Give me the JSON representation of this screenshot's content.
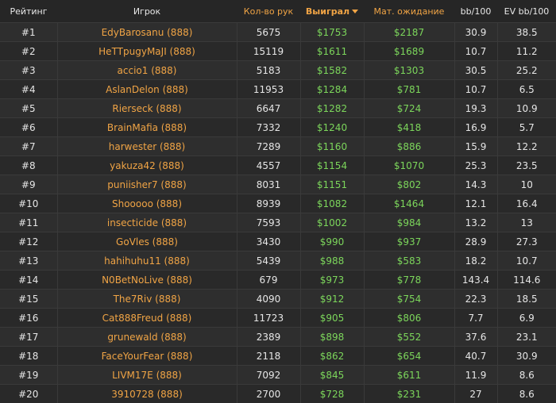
{
  "headers": {
    "rank": "Рейтинг",
    "player": "Игрок",
    "hands": "Кол-во рук",
    "won": "Выиграл",
    "ev": "Мат. ожидание",
    "bb100": "bb/100",
    "evbb100": "EV bb/100"
  },
  "sort": {
    "column": "won",
    "direction": "desc"
  },
  "colors": {
    "accent": "#f0a445",
    "money": "#7cd65b",
    "background": "#262626"
  },
  "rows": [
    {
      "rank": "#1",
      "player": "EdyBarosanu (888)",
      "hands": "5675",
      "won": "$1753",
      "ev": "$2187",
      "bb100": "30.9",
      "evbb100": "38.5"
    },
    {
      "rank": "#2",
      "player": "HeTTpugyMaJI (888)",
      "hands": "15119",
      "won": "$1611",
      "ev": "$1689",
      "bb100": "10.7",
      "evbb100": "11.2"
    },
    {
      "rank": "#3",
      "player": "accio1 (888)",
      "hands": "5183",
      "won": "$1582",
      "ev": "$1303",
      "bb100": "30.5",
      "evbb100": "25.2"
    },
    {
      "rank": "#4",
      "player": "AslanDelon (888)",
      "hands": "11953",
      "won": "$1284",
      "ev": "$781",
      "bb100": "10.7",
      "evbb100": "6.5"
    },
    {
      "rank": "#5",
      "player": "Rierseck (888)",
      "hands": "6647",
      "won": "$1282",
      "ev": "$724",
      "bb100": "19.3",
      "evbb100": "10.9"
    },
    {
      "rank": "#6",
      "player": "BrainMafia (888)",
      "hands": "7332",
      "won": "$1240",
      "ev": "$418",
      "bb100": "16.9",
      "evbb100": "5.7"
    },
    {
      "rank": "#7",
      "player": "harwester (888)",
      "hands": "7289",
      "won": "$1160",
      "ev": "$886",
      "bb100": "15.9",
      "evbb100": "12.2"
    },
    {
      "rank": "#8",
      "player": "yakuza42 (888)",
      "hands": "4557",
      "won": "$1154",
      "ev": "$1070",
      "bb100": "25.3",
      "evbb100": "23.5"
    },
    {
      "rank": "#9",
      "player": "puniisher7 (888)",
      "hands": "8031",
      "won": "$1151",
      "ev": "$802",
      "bb100": "14.3",
      "evbb100": "10"
    },
    {
      "rank": "#10",
      "player": "Shooooo (888)",
      "hands": "8939",
      "won": "$1082",
      "ev": "$1464",
      "bb100": "12.1",
      "evbb100": "16.4"
    },
    {
      "rank": "#11",
      "player": "insecticide (888)",
      "hands": "7593",
      "won": "$1002",
      "ev": "$984",
      "bb100": "13.2",
      "evbb100": "13"
    },
    {
      "rank": "#12",
      "player": "GoVles (888)",
      "hands": "3430",
      "won": "$990",
      "ev": "$937",
      "bb100": "28.9",
      "evbb100": "27.3"
    },
    {
      "rank": "#13",
      "player": "hahihuhu11 (888)",
      "hands": "5439",
      "won": "$988",
      "ev": "$583",
      "bb100": "18.2",
      "evbb100": "10.7"
    },
    {
      "rank": "#14",
      "player": "N0BetNoLive (888)",
      "hands": "679",
      "won": "$973",
      "ev": "$778",
      "bb100": "143.4",
      "evbb100": "114.6"
    },
    {
      "rank": "#15",
      "player": "The7Riv (888)",
      "hands": "4090",
      "won": "$912",
      "ev": "$754",
      "bb100": "22.3",
      "evbb100": "18.5"
    },
    {
      "rank": "#16",
      "player": "Cat888Freud (888)",
      "hands": "11723",
      "won": "$905",
      "ev": "$806",
      "bb100": "7.7",
      "evbb100": "6.9"
    },
    {
      "rank": "#17",
      "player": "grunewald (888)",
      "hands": "2389",
      "won": "$898",
      "ev": "$552",
      "bb100": "37.6",
      "evbb100": "23.1"
    },
    {
      "rank": "#18",
      "player": "FaceYourFear (888)",
      "hands": "2118",
      "won": "$862",
      "ev": "$654",
      "bb100": "40.7",
      "evbb100": "30.9"
    },
    {
      "rank": "#19",
      "player": "LIVM17E (888)",
      "hands": "7092",
      "won": "$845",
      "ev": "$611",
      "bb100": "11.9",
      "evbb100": "8.6"
    },
    {
      "rank": "#20",
      "player": "3910728 (888)",
      "hands": "2700",
      "won": "$728",
      "ev": "$231",
      "bb100": "27",
      "evbb100": "8.6"
    }
  ]
}
